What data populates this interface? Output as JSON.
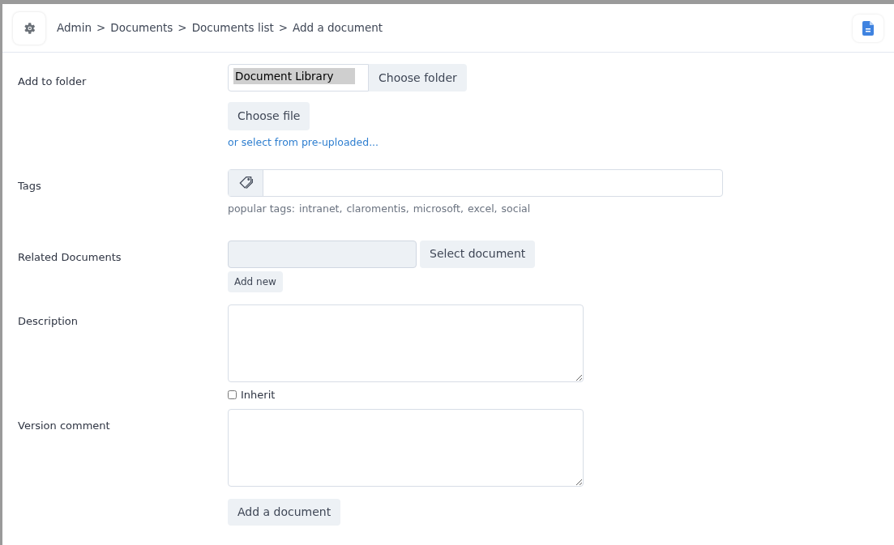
{
  "breadcrumbs": [
    {
      "label": "Admin"
    },
    {
      "label": "Documents"
    },
    {
      "label": "Documents list"
    },
    {
      "label": "Add a document"
    }
  ],
  "breadcrumb_separator": ">",
  "folder": {
    "label": "Add to folder",
    "value": "Document Library",
    "button": "Choose folder"
  },
  "file": {
    "button": "Choose file",
    "link": "or select from pre-uploaded..."
  },
  "tags": {
    "label": "Tags",
    "popular_label": "popular tags:",
    "popular": [
      "intranet,",
      "claromentis,",
      "microsoft,",
      "excel,",
      "social"
    ]
  },
  "related": {
    "label": "Related Documents",
    "button": "Select document",
    "add_button": "Add new"
  },
  "description": {
    "label": "Description",
    "inherit": {
      "label": "Inherit",
      "checked": false
    }
  },
  "version_comment": {
    "label": "Version comment"
  },
  "submit": "Add a document"
}
